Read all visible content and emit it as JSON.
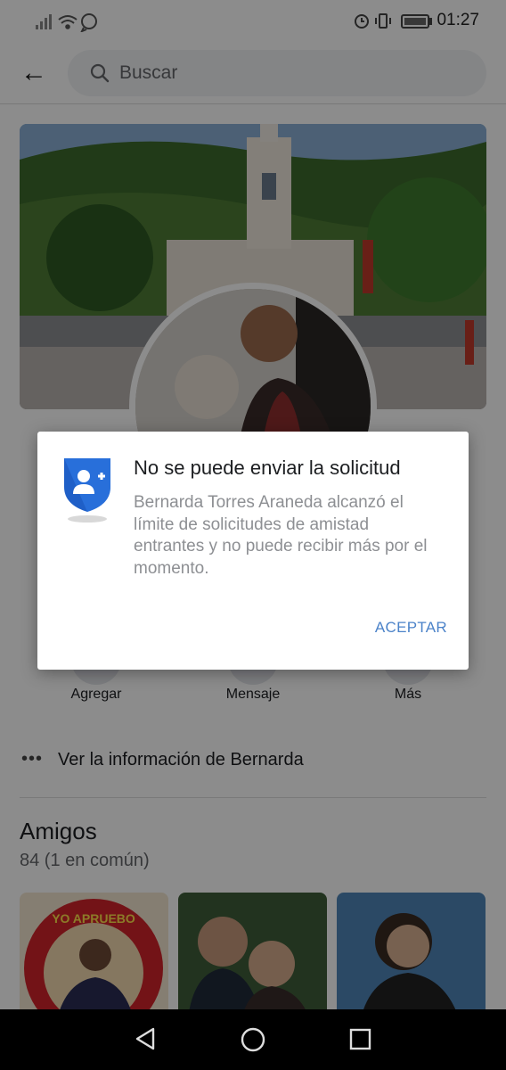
{
  "status_bar": {
    "time": "01:27"
  },
  "header": {
    "search_placeholder": "Buscar"
  },
  "actions": [
    {
      "label": "Agregar"
    },
    {
      "label": "Mensaje"
    },
    {
      "label": "Más"
    }
  ],
  "info": {
    "label": "Ver la información de Bernarda"
  },
  "friends": {
    "title": "Amigos",
    "count": "84 (1 en común)",
    "tile_text": "YO APRUEBO"
  },
  "dialog": {
    "title": "No se puede enviar la solicitud",
    "body": "Bernarda Torres Araneda alcanzó el límite de solicitudes de amistad entrantes y no puede recibir más por el momento.",
    "accept": "ACEPTAR",
    "icon": "add-friend-shield-icon"
  },
  "colors": {
    "accent": "#4c83c9",
    "shield": "#1877f2",
    "overlay": "rgba(0,0,0,0.45)"
  }
}
